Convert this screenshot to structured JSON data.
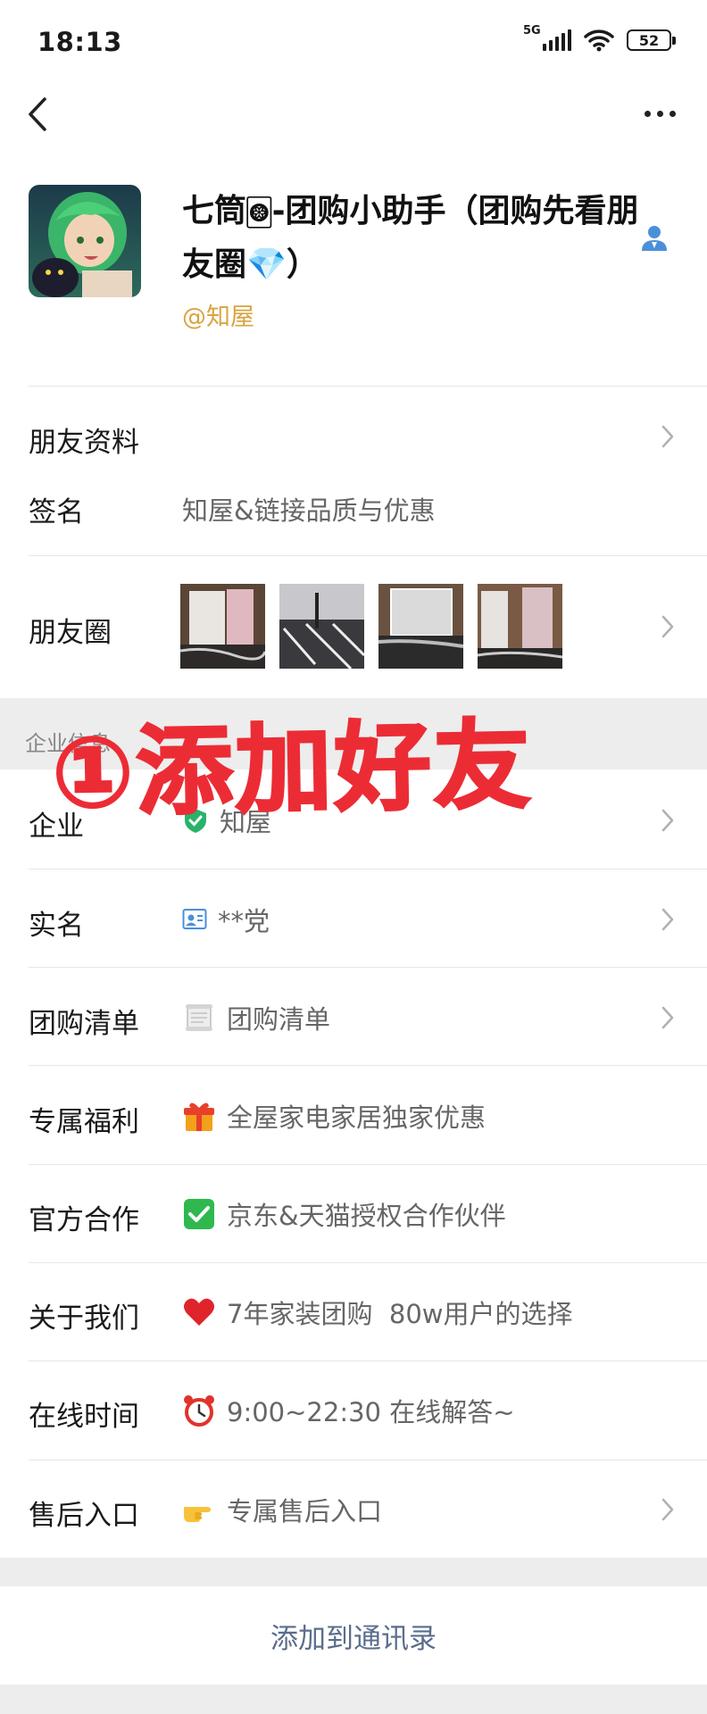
{
  "status_bar": {
    "time": "18:13",
    "network": "5G",
    "battery": "52"
  },
  "profile": {
    "name": "七筒🀙-团购小助手（团购先看朋友圈💎）",
    "org": "@知屋"
  },
  "rows": {
    "friend_info": {
      "label": "朋友资料"
    },
    "signature": {
      "label": "签名",
      "value": "知屋&链接品质与优惠"
    },
    "moments": {
      "label": "朋友圈"
    }
  },
  "section": {
    "title": "企业信息"
  },
  "overlay": {
    "text": "①添加好友"
  },
  "enterprise": {
    "company": {
      "label": "企业",
      "value": "知屋"
    },
    "realname": {
      "label": "实名",
      "value": "**党"
    },
    "group_list": {
      "label": "团购清单",
      "value": "团购清单"
    },
    "benefit": {
      "label": "专属福利",
      "value": "全屋家电家居独家优惠"
    },
    "partner": {
      "label": "官方合作",
      "value": "京东&天猫授权合作伙伴"
    },
    "about": {
      "label": "关于我们",
      "value": "7年家装团购  80w用户的选择"
    },
    "online": {
      "label": "在线时间",
      "value": "9:00~22:30 在线解答~"
    },
    "aftersale": {
      "label": "售后入口",
      "value": "专属售后入口"
    }
  },
  "actions": {
    "add_contact": "添加到通讯录"
  }
}
